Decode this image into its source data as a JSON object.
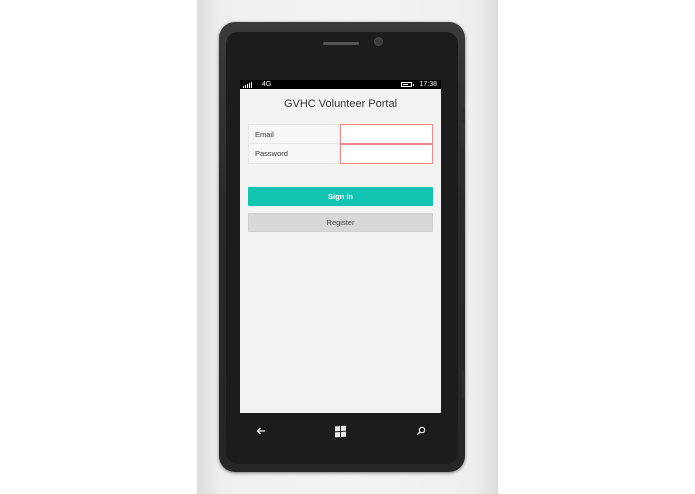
{
  "status_bar": {
    "network": "4G",
    "time": "17:38"
  },
  "app": {
    "title": "GVHC Volunteer Portal"
  },
  "form": {
    "email_label": "Email",
    "email_value": "",
    "password_label": "Password",
    "password_value": ""
  },
  "buttons": {
    "sign_in": "Sign in",
    "register": "Register"
  },
  "nav": {
    "back_icon": "back-arrow-icon",
    "start_icon": "windows-start-icon",
    "search_icon": "search-icon"
  },
  "colors": {
    "accent": "#12c3b0",
    "invalid_border": "#f08a8a",
    "screen_bg": "#f3f3f3"
  }
}
